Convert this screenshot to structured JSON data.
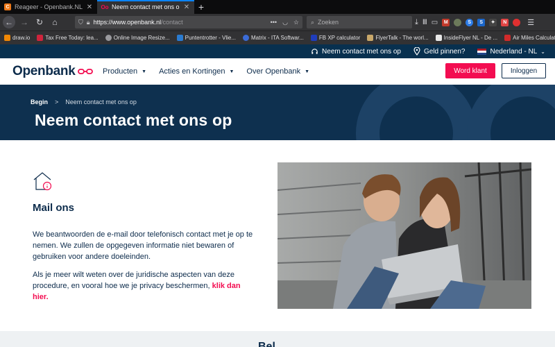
{
  "browser": {
    "tabs": [
      {
        "title": "Reageer - Openbank.NL - Perso",
        "active": false
      },
      {
        "title": "Neem contact met ons op | Ope",
        "active": true
      }
    ],
    "url_base": "https://www.openbank.nl",
    "url_path": "/contact",
    "url_more": "•••",
    "search_placeholder": "Zoeken",
    "new_tab": "+",
    "menu_icon": "☰"
  },
  "bookmarks": [
    {
      "label": "draw.io",
      "icon": "drawio-icon",
      "color": "#f08705"
    },
    {
      "label": "Tax Free Today: lea...",
      "icon": "taxfree-icon",
      "color": "#d0243c"
    },
    {
      "label": "Online Image Resize...",
      "icon": "globe-icon",
      "color": "#9a9a9e"
    },
    {
      "label": "Puntentrotter - Vlie...",
      "icon": "puntentrotter-icon",
      "color": "#2a7bd0"
    },
    {
      "label": "Matrix - ITA Softwar...",
      "icon": "matrix-icon",
      "color": "#3b6bd6"
    },
    {
      "label": "FB XP calculator",
      "icon": "fb-icon",
      "color": "#1f3dbb"
    },
    {
      "label": "FlyerTalk - The worl...",
      "icon": "flyertalk-icon",
      "color": "#c9a86a"
    },
    {
      "label": "InsideFlyer NL - De ...",
      "icon": "insideflyer-icon",
      "color": "#e8e8e8"
    },
    {
      "label": "Air Miles Calculator",
      "icon": "airmiles-icon",
      "color": "#d12a2a"
    }
  ],
  "utility": {
    "contact": "Neem contact met ons op",
    "atm": "Geld pinnen?",
    "country": "Nederland - NL"
  },
  "nav": {
    "logo": "Openbank",
    "menu": [
      "Producten",
      "Acties en Kortingen",
      "Over Openbank"
    ],
    "cta": "Word klant",
    "login": "Inloggen"
  },
  "hero": {
    "breadcrumb_home": "Begin",
    "breadcrumb_sep": ">",
    "breadcrumb_current": "Neem contact met ons op",
    "title": "Neem contact met ons op"
  },
  "main": {
    "heading": "Mail ons",
    "p1": "We beantwoorden de e-mail door telefonisch contact met je op te nemen. We zullen de opgegeven informatie niet bewaren of gebruiken voor andere doeleinden.",
    "p2": "Als je meer wilt weten over de juridische aspecten van deze procedure, en vooral hoe we je privacy beschermen,",
    "p2_link": "klik dan hier."
  },
  "bottom": {
    "heading": "Bel"
  },
  "colors": {
    "brand_navy": "#0c2b4b",
    "brand_red": "#f30d51",
    "hero_bg": "#0e304f"
  }
}
